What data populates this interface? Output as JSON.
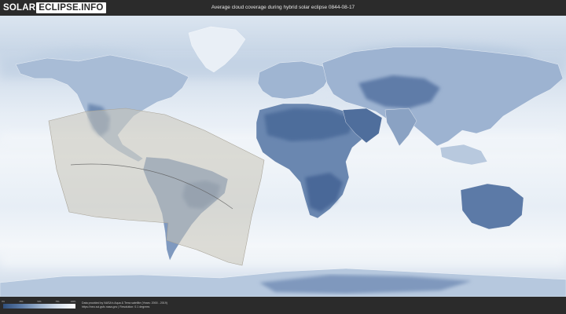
{
  "header": {
    "logo_part_a": "SOLAR",
    "logo_part_b": "ECLIPSE.INFO",
    "title": "Average cloud coverage during hybrid solar eclipse 0844-08-17"
  },
  "map": {
    "colors": {
      "ocean_light": "#eef3f8",
      "land_clear": "#4d6c9a",
      "land_mid": "#8aa3c4",
      "eclipse_band": "#c9c4b8"
    }
  },
  "scale": {
    "ticks": [
      "0%",
      "25%",
      "50%",
      "75%",
      "100%"
    ]
  },
  "footer": {
    "credit_line1": "Data provided by NASA's Aqua & Terra satellite (Years: 2000 - 2019)",
    "credit_line2": "https://neo.sci.gsfc.nasa.gov | Resolution: 0.1 degrees"
  }
}
